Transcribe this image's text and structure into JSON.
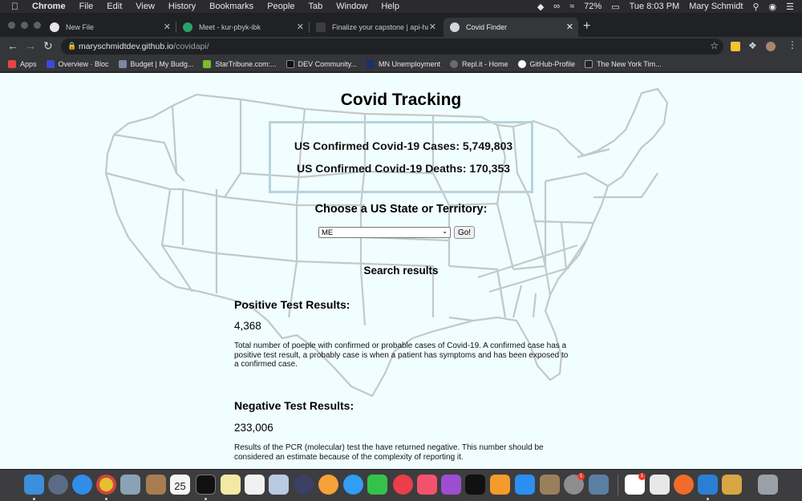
{
  "menubar": {
    "apple_icon": "apple-icon",
    "app_name": "Chrome",
    "items": [
      "File",
      "Edit",
      "View",
      "History",
      "Bookmarks",
      "People",
      "Tab",
      "Window",
      "Help"
    ],
    "battery": "72%",
    "datetime": "Tue 8:03 PM",
    "user": "Mary Schmidt"
  },
  "tabs": [
    {
      "label": "New File",
      "icon": "github-icon"
    },
    {
      "label": "Meet - kur-pbyk-ibk",
      "icon": "meet-icon"
    },
    {
      "label": "Finalize your capstone | api-ha",
      "icon": "doc-icon"
    },
    {
      "label": "Covid Finder",
      "icon": "globe-icon"
    }
  ],
  "address": {
    "host": "maryschmidtdev.github.io",
    "path": "/covidapi/"
  },
  "bookmarks": [
    {
      "label": "Apps",
      "color": "#e8453c"
    },
    {
      "label": "Overview · Bloc",
      "color": "#3b4bd8"
    },
    {
      "label": "Budget | My Budg...",
      "color": "#7a8aa0"
    },
    {
      "label": "StarTribune.com:...",
      "color": "#7dbb2c"
    },
    {
      "label": "DEV Community...",
      "color": "#111111"
    },
    {
      "label": "MN Unemployment",
      "color": "#1d2f6f"
    },
    {
      "label": "Repl.it - Home",
      "color": "#6b6b6b"
    },
    {
      "label": "GitHub-Profile",
      "color": "#ffffff"
    },
    {
      "label": "The New York Tim...",
      "color": "#222222"
    }
  ],
  "page": {
    "title": "Covid Tracking",
    "cases_text": "US Confirmed Covid-19 Cases: 5,749,803",
    "deaths_text": "US Confirmed Covid-19 Deaths: 170,353",
    "choose_label": "Choose a US State or Territory:",
    "selected_state": "ME",
    "go_label": "Go!",
    "search_results": "Search results",
    "positive": {
      "heading": "Positive Test Results:",
      "value": "4,368",
      "description": "Total number of poeple with confirmed or probable cases of Covid-19. A confirmed case has a positive test result, a probably case is when a patient has symptoms and has been exposed to a confirmed case."
    },
    "negative": {
      "heading": "Negative Test Results:",
      "value": "233,006",
      "description": "Results of the PCR (molecular) test the have returned negative. This number should be considered an estimate because of the complexity of reporting it."
    }
  },
  "dock": {
    "calendar_day": "25",
    "mail_badge": "1",
    "slack_badge": "1"
  },
  "colors": {
    "page_bg": "#f1feff",
    "box_border": "#b7d3de",
    "map_stroke": "#c3c8c9"
  }
}
